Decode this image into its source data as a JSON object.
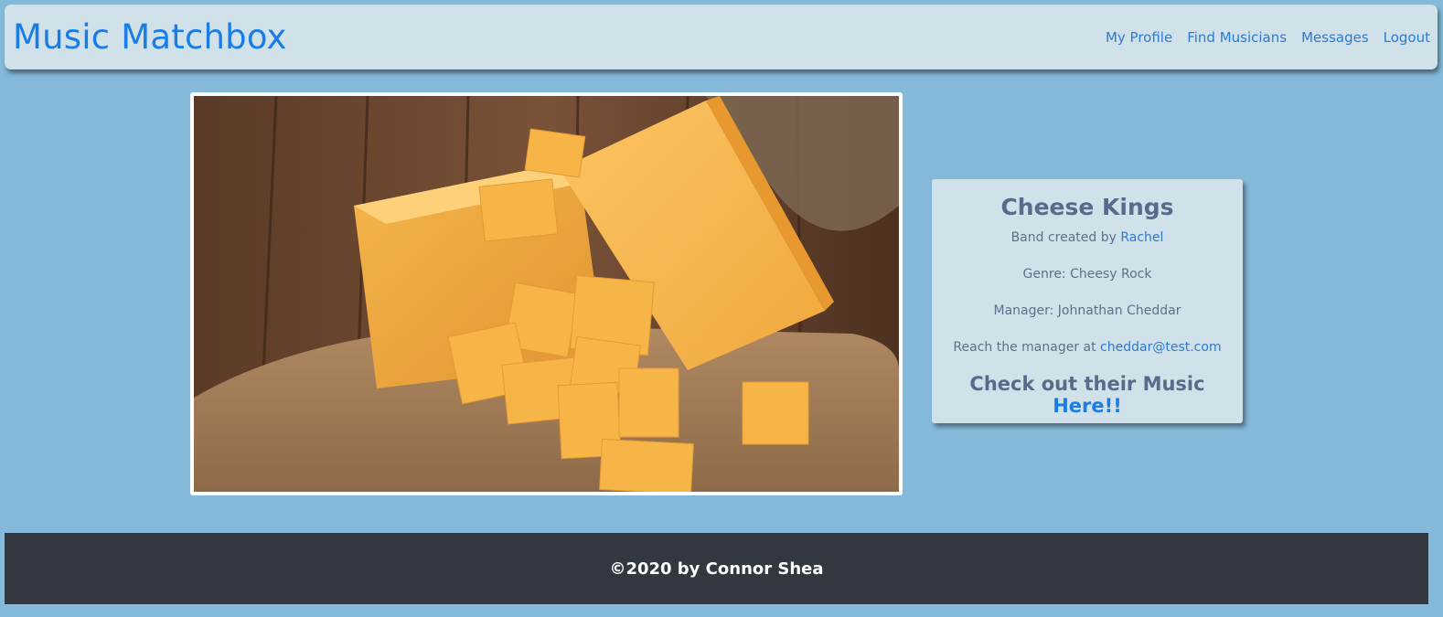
{
  "navbar": {
    "brand": "Music Matchbox",
    "links": [
      "My Profile",
      "Find Musicians",
      "Messages",
      "Logout"
    ]
  },
  "band": {
    "name": "Cheese Kings",
    "created_by_prefix": "Band created by ",
    "created_by_name": "Rachel",
    "genre_line": "Genre: Cheesy Rock",
    "manager_line": "Manager: Johnathan Cheddar",
    "reach_prefix": "Reach the manager at ",
    "reach_email": "cheddar@test.com",
    "music_prefix": "Check out their Music ",
    "music_link": "Here!!"
  },
  "footer": {
    "text": "©2020 by Connor Shea"
  },
  "colors": {
    "background": "#84b9d9",
    "navbar": "#d0e1ea",
    "brand": "#1a7de6",
    "link": "#2b7bd0",
    "card_text": "#5e6f8a",
    "footer": "#33373f"
  },
  "images": {
    "hero": "cheddar-cheese-photo"
  }
}
